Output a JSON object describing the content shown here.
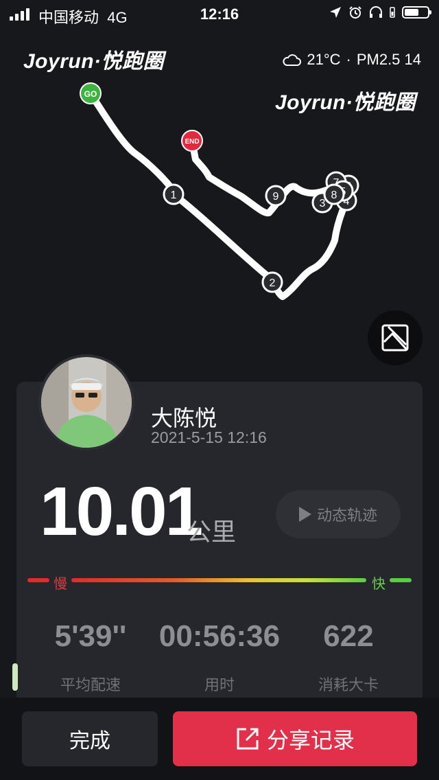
{
  "status_bar": {
    "carrier": "中国移动",
    "network": "4G",
    "time": "12:16"
  },
  "brand": {
    "name": "Joyrun",
    "separator": "·",
    "cn_name": "悦跑圈"
  },
  "weather": {
    "icon": "cloud-icon",
    "temp": "21°C",
    "dot": "·",
    "pm": "PM2.5 14"
  },
  "map": {
    "start_label": "GO",
    "end_label": "END",
    "start_color": "#3fb33f",
    "end_color": "#e5283b",
    "km_markers": [
      "1",
      "2",
      "3",
      "4",
      "5",
      "6",
      "7",
      "8",
      "9"
    ]
  },
  "user": {
    "name": "大陈悦",
    "datetime": "2021-5-15 12:16"
  },
  "run": {
    "distance": "10.01",
    "unit": "公里",
    "dynamic_button": "动态轨迹",
    "slow": "慢",
    "fast": "快"
  },
  "stats": [
    {
      "value": "5'39''",
      "label": "平均配速"
    },
    {
      "value": "00:56:36",
      "label": "用时"
    },
    {
      "value": "622",
      "label": "消耗大卡"
    }
  ],
  "actions": {
    "done": "完成",
    "share": "分享记录"
  },
  "colors": {
    "accent": "#e2304a",
    "background": "#17181b",
    "card": "#25272d"
  }
}
